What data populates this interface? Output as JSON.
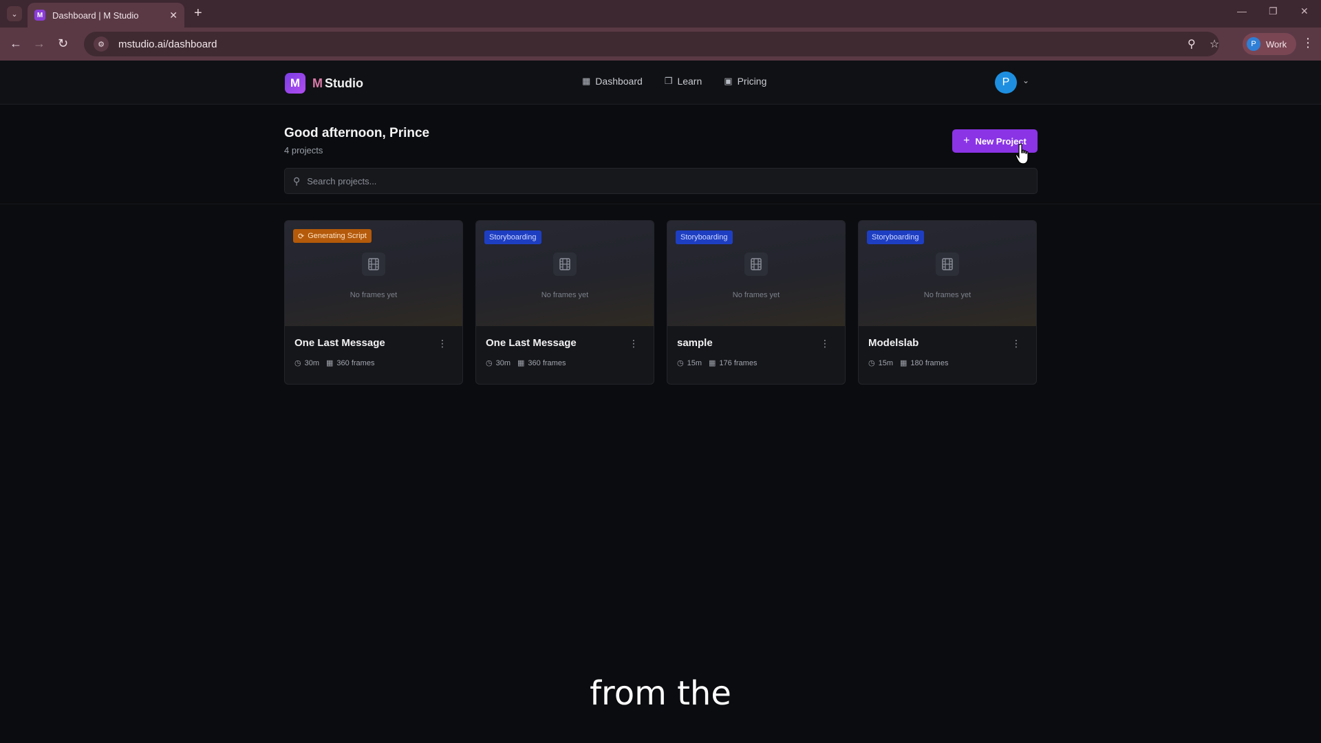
{
  "browser": {
    "tab_title": "Dashboard | M Studio",
    "favicon_letter": "M",
    "url": "mstudio.ai/dashboard",
    "profile_initial": "P",
    "profile_label": "Work",
    "icons": [
      "tab-list-icon",
      "close-icon",
      "plus-icon",
      "back-icon",
      "forward-icon",
      "reload-icon",
      "site-settings-icon",
      "zoom-icon",
      "star-icon",
      "kebab-icon"
    ]
  },
  "app": {
    "logo_letter": "M",
    "logo_m": "M",
    "logo_studio": "Studio",
    "nav": [
      {
        "label": "Dashboard",
        "icon": "grid-icon"
      },
      {
        "label": "Learn",
        "icon": "book-icon"
      },
      {
        "label": "Pricing",
        "icon": "card-icon"
      }
    ],
    "user_initial": "P"
  },
  "main": {
    "greeting": "Good afternoon, Prince",
    "project_count": "4 projects",
    "new_project_label": "New Project",
    "search_placeholder": "Search projects..."
  },
  "projects": [
    {
      "status": "Generating Script",
      "status_type": "generating",
      "empty_text": "No frames yet",
      "name": "One Last Message",
      "duration": "30m",
      "frames": "360 frames"
    },
    {
      "status": "Storyboarding",
      "status_type": "storyboarding",
      "empty_text": "No frames yet",
      "name": "One Last Message",
      "duration": "30m",
      "frames": "360 frames"
    },
    {
      "status": "Storyboarding",
      "status_type": "storyboarding",
      "empty_text": "No frames yet",
      "name": "sample",
      "duration": "15m",
      "frames": "176 frames"
    },
    {
      "status": "Storyboarding",
      "status_type": "storyboarding",
      "empty_text": "No frames yet",
      "name": "Modelslab",
      "duration": "15m",
      "frames": "180 frames"
    }
  ],
  "caption": "from the",
  "colors": {
    "accent": "#8a34e6",
    "generating": "#b45a0a",
    "storyboarding": "#1e3ec2",
    "avatar": "#1e8fe0"
  }
}
